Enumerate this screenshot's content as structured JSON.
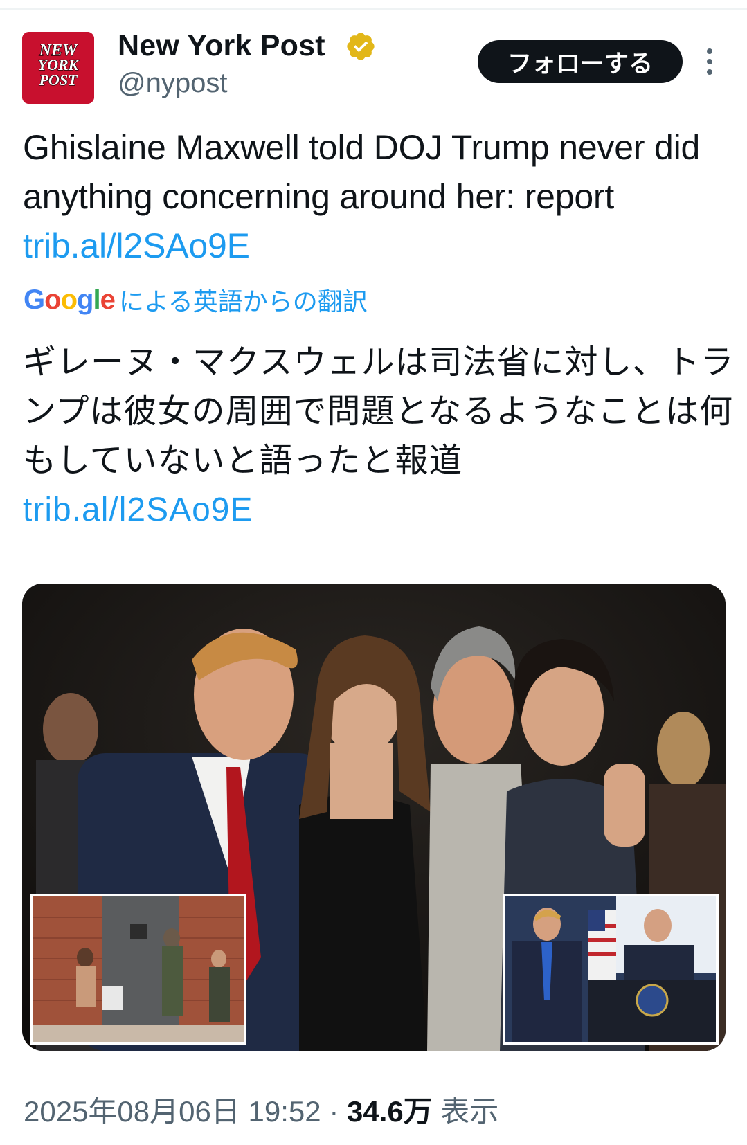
{
  "header": {
    "avatar_text": "NEW YORK POST",
    "display_name": "New York Post",
    "handle": "@nypost",
    "follow_label": "フォローする"
  },
  "tweet": {
    "text": "Ghislaine Maxwell told DOJ Trump never did anything concerning around her: report",
    "link": "trib.al/l2SAo9E"
  },
  "translation": {
    "google_word": "Google",
    "label": "による英語からの翻訳",
    "text": "ギレーヌ・マクスウェルは司法省に対し、トランプは彼女の周囲で問題となるようなことは何もしていないと語ったと報道",
    "link": "trib.al/l2SAo9E"
  },
  "meta": {
    "date": "2025年08月06日",
    "time": "19:52",
    "separator": "·",
    "views_count": "34.6万",
    "views_label": "表示"
  },
  "colors": {
    "link": "#1d9bf0",
    "secondary_text": "#536471",
    "verified_badge": "#e2b719",
    "brand_red": "#c8102e"
  },
  "icons": {
    "verified": "verified-badge-icon",
    "more": "more-vertical-icon"
  }
}
